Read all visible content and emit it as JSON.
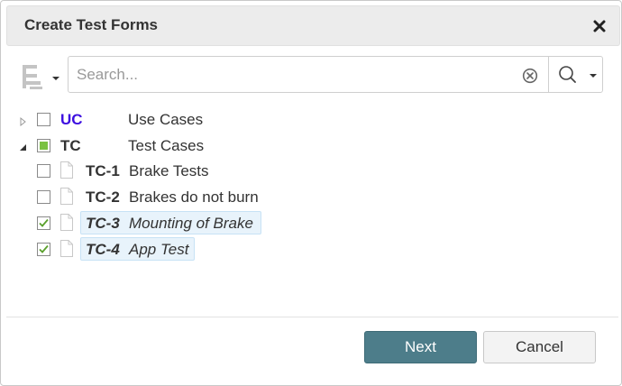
{
  "dialog": {
    "title": "Create Test Forms",
    "close_icon": "close-icon"
  },
  "toolbar": {
    "tree_icon": "hierarchy-icon",
    "search_placeholder": "Search...",
    "search_value": "",
    "clear_icon": "clear-circle-icon",
    "search_icon": "magnifier-icon"
  },
  "tree": {
    "items": [
      {
        "code": "UC",
        "label": "Use Cases",
        "level": 0,
        "expanded": false,
        "checked": "unchecked"
      },
      {
        "code": "TC",
        "label": "Test Cases",
        "level": 0,
        "expanded": true,
        "checked": "partial"
      },
      {
        "code": "TC-1",
        "label": "Brake Tests",
        "level": 1,
        "checked": "unchecked",
        "selected": false
      },
      {
        "code": "TC-2",
        "label": "Brakes do not burn",
        "level": 1,
        "checked": "unchecked",
        "selected": false
      },
      {
        "code": "TC-3",
        "label": "Mounting of Brake",
        "level": 1,
        "checked": "checked",
        "selected": true
      },
      {
        "code": "TC-4",
        "label": "App Test",
        "level": 1,
        "checked": "checked",
        "selected": true
      }
    ]
  },
  "footer": {
    "next_label": "Next",
    "cancel_label": "Cancel"
  },
  "colors": {
    "primary_button": "#4d7d8a",
    "uc_code": "#3d0fe0",
    "check_green": "#7ac142",
    "selection_bg": "#e8f3fb"
  }
}
